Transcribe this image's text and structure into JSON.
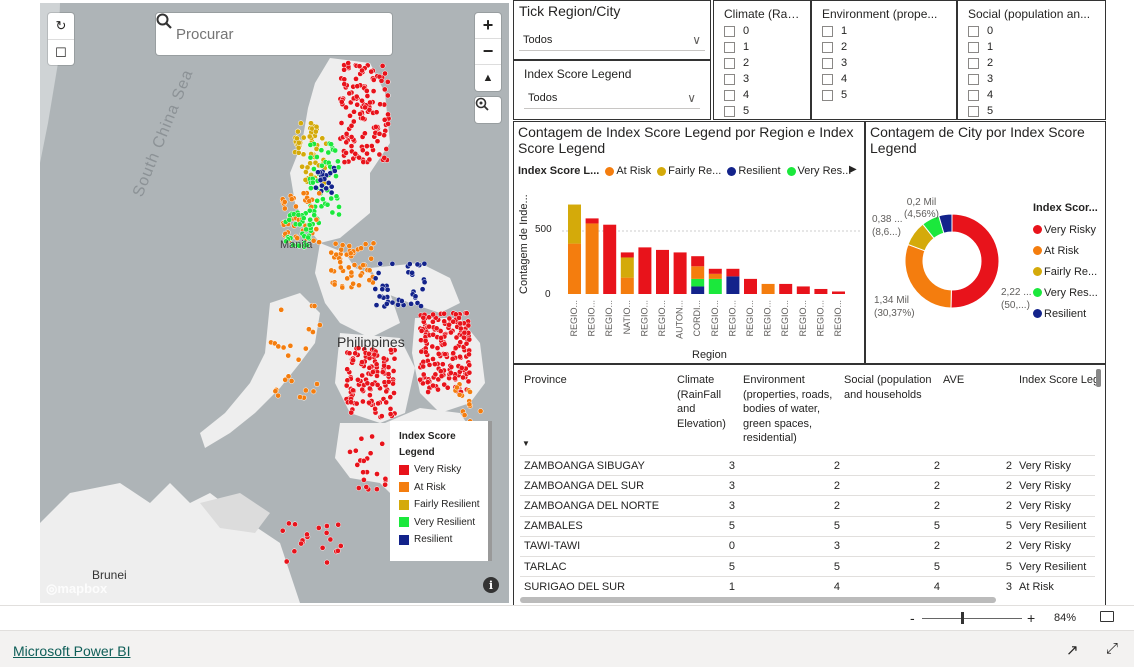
{
  "map": {
    "search_placeholder": "Procurar",
    "labels": {
      "sea": "South China Sea",
      "country": "Philippines",
      "manila": "Manila",
      "brunei": "Brunei"
    },
    "mapbox": "mapbox",
    "legend_title": "Index Score Legend",
    "legend": [
      {
        "label": "Very Risky",
        "color": "#e8131b"
      },
      {
        "label": "At Risk",
        "color": "#f47d0e"
      },
      {
        "label": "Fairly Resilient",
        "color": "#d4aa0a"
      },
      {
        "label": "Very Resilient",
        "color": "#1be83c"
      },
      {
        "label": "Resilient",
        "color": "#13238b"
      }
    ]
  },
  "slicers": {
    "region_city": {
      "title": "Tick Region/City",
      "value": "Todos"
    },
    "index_legend": {
      "title": "Index Score Legend",
      "value": "Todos"
    },
    "climate": {
      "title": "Climate (RainFal",
      "items": [
        "0",
        "1",
        "2",
        "3",
        "4",
        "5"
      ]
    },
    "environment": {
      "title": "Environment (prope...",
      "items": [
        "1",
        "2",
        "3",
        "4",
        "5"
      ]
    },
    "social": {
      "title": "Social (population an...",
      "items": [
        "0",
        "1",
        "2",
        "3",
        "4",
        "5"
      ]
    }
  },
  "bar_visual": {
    "title": "Contagem de Index Score Legend por Region e Index Score Legend",
    "legend_title": "Index Score L...",
    "legend_items": [
      "At Risk",
      "Fairly Re...",
      "Resilient",
      "Very Res..."
    ],
    "ylabel": "Contagem de Inde...",
    "xlabel": "Region",
    "yticks": [
      "500",
      "0"
    ]
  },
  "donut_visual": {
    "title": "Contagem de City por Index Score Legend",
    "legend_title": "Index Scor...",
    "legend_items": [
      {
        "label": "Very Risky",
        "color": "#e8131b"
      },
      {
        "label": "At Risk",
        "color": "#f47d0e"
      },
      {
        "label": "Fairly Re...",
        "color": "#d4aa0a"
      },
      {
        "label": "Very Res...",
        "color": "#1be83c"
      },
      {
        "label": "Resilient",
        "color": "#13238b"
      }
    ],
    "labels": {
      "a1": "0,2 Mil",
      "a2": "(4,56%)",
      "b1": "0,38 ...",
      "b2": "(8,6...)",
      "c1": "1,34 Mil",
      "c2": "(30,37%)",
      "d1": "2,22 ...",
      "d2": "(50,...)"
    }
  },
  "chart_data": [
    {
      "type": "bar",
      "title": "Contagem de Index Score Legend por Region e Index Score Legend",
      "xlabel": "Region",
      "ylabel": "Contagem de Inde...",
      "categories": [
        "REGIO...",
        "REGIO...",
        "REGIO...",
        "NATIO...",
        "REGIO...",
        "REGIO...",
        "AUTON...",
        "CORDI...",
        "REGIO...",
        "REGIO...",
        "REGIO...",
        "REGIO...",
        "REGIO...",
        "REGIO...",
        "REGIO...",
        "REGIO..."
      ],
      "series": [
        {
          "name": "At Risk",
          "color": "#f47d0e",
          "values": [
            400,
            560,
            0,
            130,
            0,
            0,
            0,
            100,
            40,
            0,
            0,
            80,
            0,
            0,
            0,
            0
          ]
        },
        {
          "name": "Fairly Re...",
          "color": "#d4aa0a",
          "values": [
            310,
            0,
            0,
            160,
            0,
            0,
            0,
            0,
            0,
            0,
            0,
            0,
            0,
            0,
            0,
            0
          ]
        },
        {
          "name": "Resilient",
          "color": "#13238b",
          "values": [
            0,
            0,
            0,
            0,
            0,
            0,
            0,
            60,
            0,
            140,
            0,
            0,
            0,
            0,
            0,
            0
          ]
        },
        {
          "name": "Very Res...",
          "color": "#1be83c",
          "values": [
            0,
            0,
            0,
            0,
            0,
            0,
            0,
            60,
            120,
            0,
            0,
            0,
            0,
            0,
            0,
            0
          ]
        },
        {
          "name": "Very Risky",
          "color": "#e8131b",
          "values": [
            0,
            40,
            550,
            40,
            370,
            350,
            330,
            80,
            40,
            60,
            120,
            0,
            80,
            60,
            40,
            20
          ]
        }
      ],
      "yticks": [
        0,
        500
      ],
      "ylim": [
        0,
        760
      ]
    },
    {
      "type": "pie",
      "title": "Contagem de City por Index Score Legend",
      "slices": [
        {
          "label": "Very Risky",
          "value": 2.22,
          "percent": 50.0,
          "color": "#e8131b"
        },
        {
          "label": "At Risk",
          "value": 1.34,
          "percent": 30.37,
          "color": "#f47d0e"
        },
        {
          "label": "Fairly Re...",
          "value": 0.38,
          "percent": 8.6,
          "color": "#d4aa0a"
        },
        {
          "label": "Very Res...",
          "value": 0.27,
          "percent": 6.1,
          "color": "#1be83c"
        },
        {
          "label": "Resilient",
          "value": 0.2,
          "percent": 4.56,
          "color": "#13238b"
        }
      ]
    }
  ],
  "table": {
    "headers": {
      "province": "Province",
      "climate": "Climate (RainFall and Elevation)",
      "environment": "Environment (properties, roads, bodies of water, green spaces, residential)",
      "social": "Social (population and households",
      "ave": "AVE",
      "legend": "Index Score Leg"
    },
    "rows": [
      {
        "province": "ZAMBOANGA SIBUGAY",
        "climate": "3",
        "environment": "2",
        "social": "2",
        "ave": "2",
        "legend": "Very Risky"
      },
      {
        "province": "ZAMBOANGA DEL SUR",
        "climate": "3",
        "environment": "2",
        "social": "2",
        "ave": "2",
        "legend": "Very Risky"
      },
      {
        "province": "ZAMBOANGA DEL NORTE",
        "climate": "3",
        "environment": "2",
        "social": "2",
        "ave": "2",
        "legend": "Very Risky"
      },
      {
        "province": "ZAMBALES",
        "climate": "5",
        "environment": "5",
        "social": "5",
        "ave": "5",
        "legend": "Very Resilient"
      },
      {
        "province": "TAWI-TAWI",
        "climate": "0",
        "environment": "3",
        "social": "2",
        "ave": "2",
        "legend": "Very Risky"
      },
      {
        "province": "TARLAC",
        "climate": "5",
        "environment": "5",
        "social": "5",
        "ave": "5",
        "legend": "Very Resilient"
      },
      {
        "province": "SURIGAO DEL SUR",
        "climate": "1",
        "environment": "4",
        "social": "4",
        "ave": "3",
        "legend": "At Risk"
      }
    ]
  },
  "zoom": {
    "minus": "-",
    "plus": "+",
    "level": "84%"
  },
  "footer": {
    "brand": "Microsoft Power BI"
  }
}
